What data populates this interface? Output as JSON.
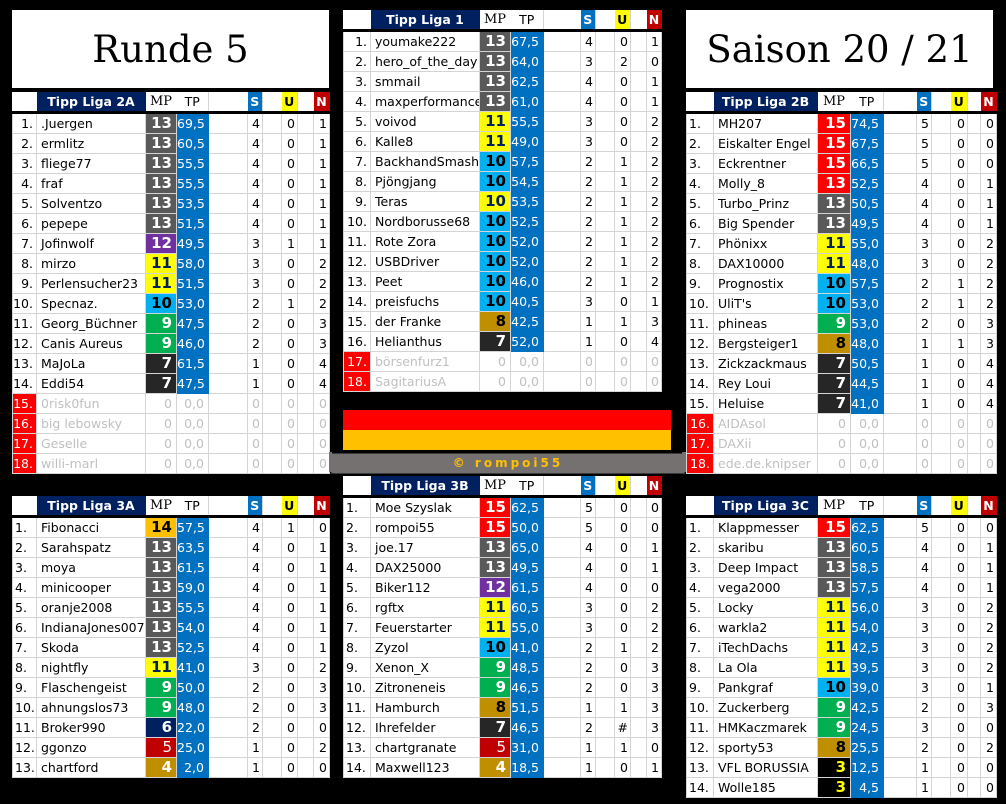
{
  "titles": {
    "left": "Runde 5",
    "right": "Saison 20 / 21"
  },
  "headers": {
    "mp": "MP",
    "tp": "TP",
    "s": "S",
    "u": "U",
    "n": "N"
  },
  "credit": "© rompoi55",
  "leagues": {
    "l2a": {
      "title": "Tipp Liga 2A",
      "rows": [
        {
          "rank": "1.",
          "name": ".Juergen",
          "mp": "13",
          "tp": "69,5",
          "s": "4",
          "u": "0",
          "n": "1"
        },
        {
          "rank": "2.",
          "name": "ermlitz",
          "mp": "13",
          "tp": "60,5",
          "s": "4",
          "u": "0",
          "n": "1"
        },
        {
          "rank": "3.",
          "name": "fliege77",
          "mp": "13",
          "tp": "55,5",
          "s": "4",
          "u": "0",
          "n": "1"
        },
        {
          "rank": "4.",
          "name": "fraf",
          "mp": "13",
          "tp": "55,5",
          "s": "4",
          "u": "0",
          "n": "1"
        },
        {
          "rank": "5.",
          "name": "Solventzo",
          "mp": "13",
          "tp": "53,5",
          "s": "4",
          "u": "0",
          "n": "1"
        },
        {
          "rank": "6.",
          "name": "pepepe",
          "mp": "13",
          "tp": "51,5",
          "s": "4",
          "u": "0",
          "n": "1"
        },
        {
          "rank": "7.",
          "name": "Jofinwolf",
          "mp": "12",
          "tp": "49,5",
          "s": "3",
          "u": "1",
          "n": "1"
        },
        {
          "rank": "8.",
          "name": "mirzo",
          "mp": "11",
          "tp": "58,0",
          "s": "3",
          "u": "0",
          "n": "2"
        },
        {
          "rank": "9.",
          "name": "Perlensucher23",
          "mp": "11",
          "tp": "51,5",
          "s": "3",
          "u": "0",
          "n": "2"
        },
        {
          "rank": "10.",
          "name": "Specnaz.",
          "mp": "10",
          "tp": "53,0",
          "s": "2",
          "u": "1",
          "n": "2"
        },
        {
          "rank": "11.",
          "name": "Georg_Büchner",
          "mp": "9",
          "tp": "47,5",
          "s": "2",
          "u": "0",
          "n": "3"
        },
        {
          "rank": "12.",
          "name": "Canis Aureus",
          "mp": "9",
          "tp": "46,0",
          "s": "2",
          "u": "0",
          "n": "3"
        },
        {
          "rank": "13.",
          "name": "MaJoLa",
          "mp": "7",
          "tp": "61,5",
          "s": "1",
          "u": "0",
          "n": "4"
        },
        {
          "rank": "14.",
          "name": "Eddi54",
          "mp": "7",
          "tp": "47,5",
          "s": "1",
          "u": "0",
          "n": "4"
        },
        {
          "rank": "15.",
          "name": "0risk0fun",
          "mp": "0",
          "tp": "0,0",
          "s": "0",
          "u": "0",
          "n": "0",
          "inactive": true
        },
        {
          "rank": "16.",
          "name": "big lebowsky",
          "mp": "0",
          "tp": "0,0",
          "s": "0",
          "u": "0",
          "n": "0",
          "inactive": true
        },
        {
          "rank": "17.",
          "name": "Geselle",
          "mp": "0",
          "tp": "0,0",
          "s": "0",
          "u": "0",
          "n": "0",
          "inactive": true
        },
        {
          "rank": "18.",
          "name": "willi-marl",
          "mp": "0",
          "tp": "0,0",
          "s": "0",
          "u": "0",
          "n": "0",
          "inactive": true
        }
      ]
    },
    "l1": {
      "title": "Tipp Liga 1",
      "rows": [
        {
          "rank": "1.",
          "name": "youmake222",
          "mp": "13",
          "tp": "67,5",
          "s": "4",
          "u": "0",
          "n": "1"
        },
        {
          "rank": "2.",
          "name": "hero_of_the_day",
          "mp": "13",
          "tp": "64,0",
          "s": "3",
          "u": "2",
          "n": "0"
        },
        {
          "rank": "3.",
          "name": "smmail",
          "mp": "13",
          "tp": "62,5",
          "s": "4",
          "u": "0",
          "n": "1"
        },
        {
          "rank": "4.",
          "name": "maxperformance",
          "mp": "13",
          "tp": "61,0",
          "s": "4",
          "u": "0",
          "n": "1"
        },
        {
          "rank": "5.",
          "name": "voivod",
          "mp": "11",
          "tp": "55,5",
          "s": "3",
          "u": "0",
          "n": "2"
        },
        {
          "rank": "6.",
          "name": "Kalle8",
          "mp": "11",
          "tp": "49,0",
          "s": "3",
          "u": "0",
          "n": "2"
        },
        {
          "rank": "7.",
          "name": "BackhandSmash",
          "mp": "10",
          "tp": "57,5",
          "s": "2",
          "u": "1",
          "n": "2"
        },
        {
          "rank": "8.",
          "name": "Pjöngjang",
          "mp": "10",
          "tp": "54,5",
          "s": "2",
          "u": "1",
          "n": "2"
        },
        {
          "rank": "9.",
          "name": "Teras",
          "mp": "10",
          "tp": "53,5",
          "s": "2",
          "u": "1",
          "n": "2",
          "mpclass": "11"
        },
        {
          "rank": "10.",
          "name": "Nordborusse68",
          "mp": "10",
          "tp": "52,5",
          "s": "2",
          "u": "1",
          "n": "2"
        },
        {
          "rank": "11.",
          "name": "Rote Zora",
          "mp": "10",
          "tp": "52,0",
          "s": "2",
          "u": "1",
          "n": "2"
        },
        {
          "rank": "12.",
          "name": "USBDriver",
          "mp": "10",
          "tp": "52,0",
          "s": "2",
          "u": "1",
          "n": "2"
        },
        {
          "rank": "13.",
          "name": "Peet",
          "mp": "10",
          "tp": "46,0",
          "s": "2",
          "u": "1",
          "n": "2"
        },
        {
          "rank": "14.",
          "name": "preisfuchs",
          "mp": "10",
          "tp": "40,5",
          "s": "3",
          "u": "0",
          "n": "1"
        },
        {
          "rank": "15.",
          "name": "der Franke",
          "mp": "8",
          "tp": "42,5",
          "s": "1",
          "u": "1",
          "n": "3"
        },
        {
          "rank": "16.",
          "name": "Helianthus",
          "mp": "7",
          "tp": "52,0",
          "s": "1",
          "u": "0",
          "n": "4"
        },
        {
          "rank": "17.",
          "name": "börsenfurz1",
          "mp": "0",
          "tp": "0,0",
          "s": "0",
          "u": "0",
          "n": "0",
          "inactive": true
        },
        {
          "rank": "18.",
          "name": "SagitariusA",
          "mp": "0",
          "tp": "0,0",
          "s": "0",
          "u": "0",
          "n": "0",
          "inactive": true
        }
      ]
    },
    "l2b": {
      "title": "Tipp Liga 2B",
      "rows": [
        {
          "rank": "1.",
          "name": "MH207",
          "mp": "15",
          "tp": "74,5",
          "s": "5",
          "u": "0",
          "n": "0"
        },
        {
          "rank": "2.",
          "name": "Eiskalter Engel",
          "mp": "15",
          "tp": "67,5",
          "s": "5",
          "u": "0",
          "n": "0"
        },
        {
          "rank": "3.",
          "name": "Eckrentner",
          "mp": "15",
          "tp": "66,5",
          "s": "5",
          "u": "0",
          "n": "0"
        },
        {
          "rank": "4.",
          "name": "Molly_8",
          "mp": "13",
          "tp": "52,5",
          "s": "4",
          "u": "0",
          "n": "1",
          "mpclass": "15"
        },
        {
          "rank": "5.",
          "name": "Turbo_Prinz",
          "mp": "13",
          "tp": "50,5",
          "s": "4",
          "u": "0",
          "n": "1"
        },
        {
          "rank": "6.",
          "name": "Big Spender",
          "mp": "13",
          "tp": "49,5",
          "s": "4",
          "u": "0",
          "n": "1"
        },
        {
          "rank": "7.",
          "name": "Phönixx",
          "mp": "11",
          "tp": "55,0",
          "s": "3",
          "u": "0",
          "n": "2"
        },
        {
          "rank": "8.",
          "name": "DAX10000",
          "mp": "11",
          "tp": "48,0",
          "s": "3",
          "u": "0",
          "n": "2"
        },
        {
          "rank": "9.",
          "name": "Prognostix",
          "mp": "10",
          "tp": "57,5",
          "s": "2",
          "u": "1",
          "n": "2"
        },
        {
          "rank": "10.",
          "name": "UliT's",
          "mp": "10",
          "tp": "53,0",
          "s": "2",
          "u": "1",
          "n": "2"
        },
        {
          "rank": "11.",
          "name": "phineas",
          "mp": "9",
          "tp": "53,0",
          "s": "2",
          "u": "0",
          "n": "3"
        },
        {
          "rank": "12.",
          "name": "Bergsteiger1",
          "mp": "8",
          "tp": "48,0",
          "s": "1",
          "u": "1",
          "n": "3"
        },
        {
          "rank": "13.",
          "name": "Zickzackmaus",
          "mp": "7",
          "tp": "50,5",
          "s": "1",
          "u": "0",
          "n": "4"
        },
        {
          "rank": "14.",
          "name": "Rey Loui",
          "mp": "7",
          "tp": "44,5",
          "s": "1",
          "u": "0",
          "n": "4"
        },
        {
          "rank": "15.",
          "name": "Heluise",
          "mp": "7",
          "tp": "41,0",
          "s": "1",
          "u": "0",
          "n": "4"
        },
        {
          "rank": "16.",
          "name": "AIDAsol",
          "mp": "0",
          "tp": "0,0",
          "s": "0",
          "u": "0",
          "n": "0",
          "inactive": true
        },
        {
          "rank": "17.",
          "name": "DAXii",
          "mp": "0",
          "tp": "0,0",
          "s": "0",
          "u": "0",
          "n": "0",
          "inactive": true
        },
        {
          "rank": "18.",
          "name": "ede.de.knipser",
          "mp": "0",
          "tp": "0,0",
          "s": "0",
          "u": "0",
          "n": "0",
          "inactive": true
        }
      ]
    },
    "l3a": {
      "title": "Tipp Liga 3A",
      "rows": [
        {
          "rank": "1.",
          "name": "Fibonacci",
          "mp": "14",
          "tp": "57,5",
          "s": "4",
          "u": "1",
          "n": "0"
        },
        {
          "rank": "2.",
          "name": "Sarahspatz",
          "mp": "13",
          "tp": "63,5",
          "s": "4",
          "u": "0",
          "n": "1"
        },
        {
          "rank": "3.",
          "name": "moya",
          "mp": "13",
          "tp": "61,5",
          "s": "4",
          "u": "0",
          "n": "1"
        },
        {
          "rank": "4.",
          "name": "minicooper",
          "mp": "13",
          "tp": "59,0",
          "s": "4",
          "u": "0",
          "n": "1"
        },
        {
          "rank": "5.",
          "name": "oranje2008",
          "mp": "13",
          "tp": "55,5",
          "s": "4",
          "u": "0",
          "n": "1"
        },
        {
          "rank": "6.",
          "name": "IndianaJones007",
          "mp": "13",
          "tp": "54,0",
          "s": "4",
          "u": "0",
          "n": "1"
        },
        {
          "rank": "7.",
          "name": "Skoda",
          "mp": "13",
          "tp": "52,5",
          "s": "4",
          "u": "0",
          "n": "1"
        },
        {
          "rank": "8.",
          "name": "nightfly",
          "mp": "11",
          "tp": "41,0",
          "s": "3",
          "u": "0",
          "n": "2"
        },
        {
          "rank": "9.",
          "name": "Flaschengeist",
          "mp": "9",
          "tp": "50,0",
          "s": "2",
          "u": "0",
          "n": "3"
        },
        {
          "rank": "10.",
          "name": "ahnungslos73",
          "mp": "9",
          "tp": "48,0",
          "s": "2",
          "u": "0",
          "n": "3"
        },
        {
          "rank": "11.",
          "name": "Broker990",
          "mp": "6",
          "tp": "22,0",
          "s": "2",
          "u": "0",
          "n": "0"
        },
        {
          "rank": "12.",
          "name": "ggonzo",
          "mp": "5",
          "tp": "25,0",
          "s": "1",
          "u": "0",
          "n": "2"
        },
        {
          "rank": "13.",
          "name": "chartford",
          "mp": "4",
          "tp": "2,0",
          "s": "1",
          "u": "0",
          "n": "0"
        }
      ]
    },
    "l3b": {
      "title": "Tipp Liga 3B",
      "rows": [
        {
          "rank": "1.",
          "name": "Moe Szyslak",
          "mp": "15",
          "tp": "62,5",
          "s": "5",
          "u": "0",
          "n": "0"
        },
        {
          "rank": "2.",
          "name": "rompoi55",
          "mp": "15",
          "tp": "50,0",
          "s": "5",
          "u": "0",
          "n": "0"
        },
        {
          "rank": "3.",
          "name": "joe.17",
          "mp": "13",
          "tp": "65,0",
          "s": "4",
          "u": "0",
          "n": "1"
        },
        {
          "rank": "4.",
          "name": "DAX25000",
          "mp": "13",
          "tp": "49,5",
          "s": "4",
          "u": "0",
          "n": "1"
        },
        {
          "rank": "5.",
          "name": "Biker112",
          "mp": "12",
          "tp": "61,5",
          "s": "4",
          "u": "0",
          "n": "0"
        },
        {
          "rank": "6.",
          "name": "rgftx",
          "mp": "11",
          "tp": "60,5",
          "s": "3",
          "u": "0",
          "n": "2"
        },
        {
          "rank": "7.",
          "name": "Feuerstarter",
          "mp": "11",
          "tp": "55,0",
          "s": "3",
          "u": "0",
          "n": "2"
        },
        {
          "rank": "8.",
          "name": "Zyzol",
          "mp": "10",
          "tp": "41,0",
          "s": "2",
          "u": "1",
          "n": "2"
        },
        {
          "rank": "9.",
          "name": "Xenon_X",
          "mp": "9",
          "tp": "48,5",
          "s": "2",
          "u": "0",
          "n": "3"
        },
        {
          "rank": "10.",
          "name": "Zitroneneis",
          "mp": "9",
          "tp": "46,5",
          "s": "2",
          "u": "0",
          "n": "3"
        },
        {
          "rank": "11.",
          "name": "Hamburch",
          "mp": "8",
          "tp": "51,5",
          "s": "1",
          "u": "1",
          "n": "3"
        },
        {
          "rank": "12.",
          "name": "Ihrefelder",
          "mp": "7",
          "tp": "46,5",
          "s": "2",
          "u": "#",
          "n": "3"
        },
        {
          "rank": "13.",
          "name": "chartgranate",
          "mp": "5",
          "tp": "31,0",
          "s": "1",
          "u": "1",
          "n": "0"
        },
        {
          "rank": "14.",
          "name": "Maxwell123",
          "mp": "4",
          "tp": "18,5",
          "s": "1",
          "u": "0",
          "n": "1"
        }
      ]
    },
    "l3c": {
      "title": "Tipp Liga 3C",
      "rows": [
        {
          "rank": "1.",
          "name": "Klappmesser",
          "mp": "15",
          "tp": "62,5",
          "s": "5",
          "u": "0",
          "n": "0"
        },
        {
          "rank": "2.",
          "name": "skaribu",
          "mp": "13",
          "tp": "60,5",
          "s": "4",
          "u": "0",
          "n": "1"
        },
        {
          "rank": "3.",
          "name": "Deep Impact",
          "mp": "13",
          "tp": "58,5",
          "s": "4",
          "u": "0",
          "n": "1"
        },
        {
          "rank": "4.",
          "name": "vega2000",
          "mp": "13",
          "tp": "57,5",
          "s": "4",
          "u": "0",
          "n": "1"
        },
        {
          "rank": "5.",
          "name": "Locky",
          "mp": "11",
          "tp": "56,0",
          "s": "3",
          "u": "0",
          "n": "2"
        },
        {
          "rank": "6.",
          "name": "warkla2",
          "mp": "11",
          "tp": "54,0",
          "s": "3",
          "u": "0",
          "n": "2"
        },
        {
          "rank": "7.",
          "name": "iTechDachs",
          "mp": "11",
          "tp": "42,5",
          "s": "3",
          "u": "0",
          "n": "2"
        },
        {
          "rank": "8.",
          "name": "La Ola",
          "mp": "11",
          "tp": "39,5",
          "s": "3",
          "u": "0",
          "n": "2"
        },
        {
          "rank": "9.",
          "name": "Pankgraf",
          "mp": "10",
          "tp": "39,0",
          "s": "3",
          "u": "0",
          "n": "1"
        },
        {
          "rank": "10.",
          "name": "Zuckerberg",
          "mp": "9",
          "tp": "42,5",
          "s": "2",
          "u": "0",
          "n": "3"
        },
        {
          "rank": "11.",
          "name": "HMKaczmarek",
          "mp": "9",
          "tp": "24,5",
          "s": "3",
          "u": "0",
          "n": "0"
        },
        {
          "rank": "12.",
          "name": "sporty53",
          "mp": "8",
          "tp": "25,5",
          "s": "2",
          "u": "0",
          "n": "2"
        },
        {
          "rank": "13.",
          "name": "VFL BORUSSIA",
          "mp": "3",
          "tp": "12,5",
          "s": "1",
          "u": "0",
          "n": "0"
        },
        {
          "rank": "14.",
          "name": "Wolle185",
          "mp": "3",
          "tp": "4,5",
          "s": "1",
          "u": "0",
          "n": "0"
        }
      ]
    }
  }
}
